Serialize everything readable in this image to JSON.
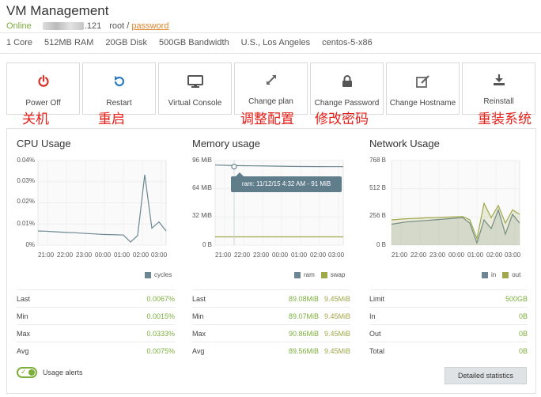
{
  "header": {
    "title": "VM Management",
    "status": "Online",
    "ip_visible_suffix": ".121",
    "user": "root",
    "separator": "/",
    "password_link": "password"
  },
  "specs": [
    "1 Core",
    "512MB RAM",
    "20GB Disk",
    "500GB Bandwidth",
    "U.S., Los Angeles",
    "centos-5-x86"
  ],
  "actions": [
    {
      "label": "Power Off",
      "icon": "power-icon",
      "annotation": "关机"
    },
    {
      "label": "Restart",
      "icon": "restart-icon",
      "annotation": "重启"
    },
    {
      "label": "Virtual Console",
      "icon": "monitor-icon",
      "annotation": ""
    },
    {
      "label": "Change plan",
      "icon": "expand-icon",
      "annotation": "调整配置"
    },
    {
      "label": "Change Password",
      "icon": "lock-icon",
      "annotation": "修改密码"
    },
    {
      "label": "Change Hostname",
      "icon": "edit-icon",
      "annotation": ""
    },
    {
      "label": "Reinstall",
      "icon": "download-icon",
      "annotation": "重装系统"
    }
  ],
  "colors": {
    "accent_green": "#7cae3c",
    "olive": "#9fa84a",
    "slate": "#6c8791",
    "orange_link": "#e0832b",
    "annotation_red": "#e4201a",
    "power_red": "#d9342b",
    "restart_blue": "#2f7dc1"
  },
  "x_ticks": [
    "21:00",
    "22:00",
    "23:00",
    "00:00",
    "01:00",
    "02:00",
    "03:00"
  ],
  "cpu": {
    "title": "CPU Usage",
    "y_ticks": [
      "0.04%",
      "0.03%",
      "0.02%",
      "0.01%",
      "0%"
    ],
    "legend": "cycles",
    "stats": [
      {
        "label": "Last",
        "value": "0.0067%"
      },
      {
        "label": "Min",
        "value": "0.0015%"
      },
      {
        "label": "Max",
        "value": "0.0333%"
      },
      {
        "label": "Avg",
        "value": "0.0075%"
      }
    ]
  },
  "memory": {
    "title": "Memory usage",
    "y_ticks": [
      "96 MiB",
      "64 MiB",
      "32 MiB",
      "0 B"
    ],
    "legend": [
      "ram",
      "swap"
    ],
    "tooltip": "ram: 11/12/15 4:32 AM - 91 MiB",
    "stats": [
      {
        "label": "Last",
        "ram": "89.08MiB",
        "swap": "9.45MiB"
      },
      {
        "label": "Min",
        "ram": "89.07MiB",
        "swap": "9.45MiB"
      },
      {
        "label": "Max",
        "ram": "90.86MiB",
        "swap": "9.45MiB"
      },
      {
        "label": "Avg",
        "ram": "89.56MiB",
        "swap": "9.45MiB"
      }
    ]
  },
  "network": {
    "title": "Network Usage",
    "y_ticks": [
      "768 B",
      "512 B",
      "256 B",
      "0 B"
    ],
    "legend": [
      "in",
      "out"
    ],
    "stats": [
      {
        "label": "Limit",
        "value": "500GB"
      },
      {
        "label": "In",
        "value": "0B"
      },
      {
        "label": "Out",
        "value": "0B"
      },
      {
        "label": "Total",
        "value": "0B"
      }
    ]
  },
  "chart_data": [
    {
      "type": "line",
      "title": "CPU Usage",
      "x": [
        "21:00",
        "22:00",
        "23:00",
        "00:00",
        "01:00",
        "02:00",
        "03:00"
      ],
      "ylim": [
        0,
        0.04
      ],
      "series": [
        {
          "name": "cycles",
          "values": [
            0.0067,
            0.0066,
            0.0064,
            0.0062,
            0.006,
            0.0059,
            0.0057,
            0.0055,
            0.0053,
            0.0051,
            0.005,
            0.0049,
            0.0048,
            0.0015,
            0.0045,
            0.0333,
            0.008,
            0.011,
            0.0067
          ]
        }
      ]
    },
    {
      "type": "line",
      "title": "Memory usage",
      "x": [
        "21:00",
        "22:00",
        "23:00",
        "00:00",
        "01:00",
        "02:00",
        "03:00"
      ],
      "ylim": [
        0,
        96
      ],
      "series": [
        {
          "name": "ram",
          "values": [
            90.86,
            90.5,
            90.2,
            90,
            89.8,
            89.6,
            89.4,
            89.3,
            89.2,
            89.1,
            89.08
          ]
        },
        {
          "name": "swap",
          "values": [
            9.45,
            9.45,
            9.45,
            9.45,
            9.45,
            9.45,
            9.45,
            9.45,
            9.45,
            9.45,
            9.45
          ]
        }
      ]
    },
    {
      "type": "area",
      "title": "Network Usage",
      "x": [
        "21:00",
        "22:00",
        "23:00",
        "00:00",
        "01:00",
        "02:00",
        "03:00"
      ],
      "ylim": [
        0,
        768
      ],
      "series": [
        {
          "name": "in",
          "values": [
            190,
            200,
            210,
            215,
            220,
            225,
            230,
            235,
            240,
            245,
            250,
            200,
            20,
            230,
            150,
            320,
            100,
            280,
            200
          ]
        },
        {
          "name": "out",
          "values": [
            230,
            235,
            240,
            242,
            245,
            248,
            250,
            252,
            255,
            258,
            260,
            230,
            60,
            380,
            250,
            360,
            200,
            320,
            280
          ]
        }
      ]
    }
  ]
}
